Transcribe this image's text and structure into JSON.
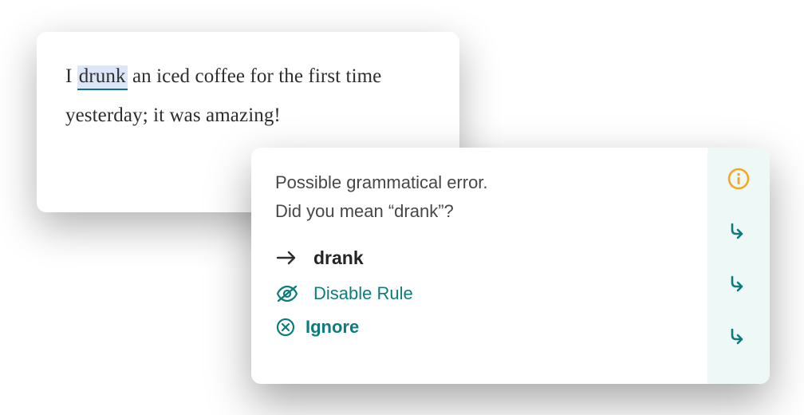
{
  "editor": {
    "prefix": "I ",
    "highlighted": "drunk",
    "suffix": " an iced coffee for the first time yesterday; it was amazing!"
  },
  "popup": {
    "message_line1": "Possible grammatical error.",
    "message_line2": "Did you mean “drank”?",
    "suggestion": "drank",
    "disable_rule_label": "Disable Rule",
    "ignore_label": "Ignore"
  },
  "colors": {
    "teal": "#0c7c7f",
    "orange": "#f5a623",
    "side_bg": "#eef8f6",
    "highlight_bg": "#dbe6f7",
    "highlight_underline": "#0b6e99"
  }
}
